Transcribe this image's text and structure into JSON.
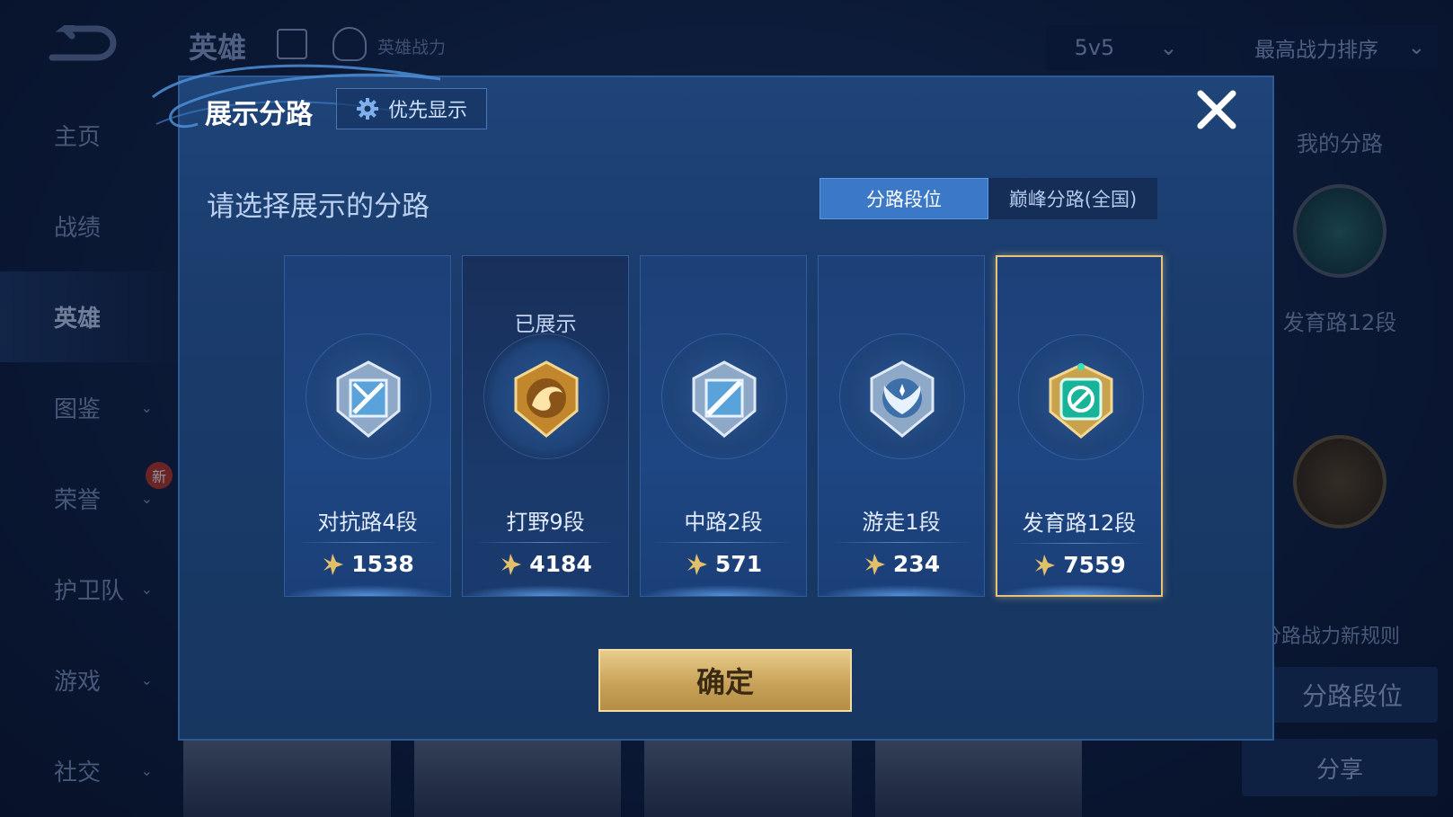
{
  "background": {
    "topbar": {
      "title": "英雄",
      "subtitle": "英雄战力",
      "mode": "5v5",
      "sort": "最高战力排序"
    },
    "sidebar": [
      {
        "label": "主页",
        "has_chevron": false
      },
      {
        "label": "战绩",
        "has_chevron": false
      },
      {
        "label": "英雄",
        "has_chevron": false,
        "active": true
      },
      {
        "label": "图鉴",
        "has_chevron": true
      },
      {
        "label": "荣誉",
        "has_chevron": true,
        "badge": "新"
      },
      {
        "label": "护卫队",
        "has_chevron": true
      },
      {
        "label": "游戏",
        "has_chevron": true
      },
      {
        "label": "社交",
        "has_chevron": true
      }
    ],
    "right_panel": {
      "my_lanes": "我的分路",
      "lane_rank": "发育路12段",
      "rule_link": "分路战力新规则",
      "rank_button": "分路段位",
      "share_button": "分享"
    }
  },
  "dialog": {
    "title": "展示分路",
    "priority_button": "优先显示",
    "subtitle": "请选择展示的分路",
    "tabs": [
      {
        "label": "分路段位",
        "active": true
      },
      {
        "label": "巅峰分路(全国)",
        "active": false
      }
    ],
    "lanes": [
      {
        "name": "对抗路4段",
        "score": "1538",
        "shown_label": "",
        "badge": "silver-sword",
        "selected": false
      },
      {
        "name": "打野9段",
        "score": "4184",
        "shown_label": "已展示",
        "badge": "gold-dragon",
        "selected": false
      },
      {
        "name": "中路2段",
        "score": "571",
        "shown_label": "",
        "badge": "silver-slash",
        "selected": false
      },
      {
        "name": "游走1段",
        "score": "234",
        "shown_label": "",
        "badge": "silver-wing",
        "selected": false
      },
      {
        "name": "发育路12段",
        "score": "7559",
        "shown_label": "",
        "badge": "emerald-s",
        "selected": true
      }
    ],
    "confirm_button": "确定"
  },
  "colors": {
    "dialog_bg": "#1e4479",
    "tab_active": "#3b78c8",
    "selected_border": "#e8c27a",
    "confirm_gold": "#c9a35a"
  }
}
